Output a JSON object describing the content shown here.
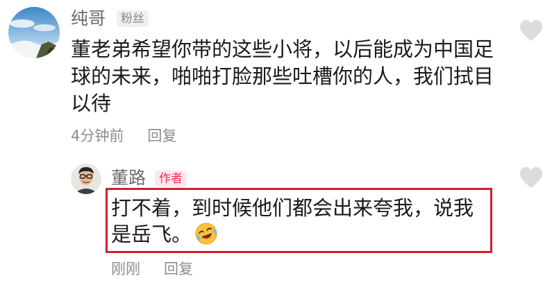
{
  "comment": {
    "username": "纯哥",
    "badge": "粉丝",
    "text": "董老弟希望你带的这些小将，以后能成为中国足球的未来，啪啪打脸那些吐槽你的人，我们拭目以待",
    "time": "4分钟前",
    "reply_label": "回复",
    "like_icon": "heart-icon"
  },
  "reply": {
    "username": "董路",
    "badge": "作者",
    "text": "打不着，到时候他们都会出来夸我，说我是岳飞。",
    "emoji_icon": "laughing-crying-emoji-icon",
    "time": "刚刚",
    "reply_label": "回复",
    "like_icon": "heart-icon",
    "highlight_color": "#d31f2a"
  },
  "colors": {
    "author_badge_bg": "#ffe8ec",
    "author_badge_text": "#fe2c55",
    "meta_text": "#8c8c8c",
    "heart": "#dcdcdc"
  }
}
